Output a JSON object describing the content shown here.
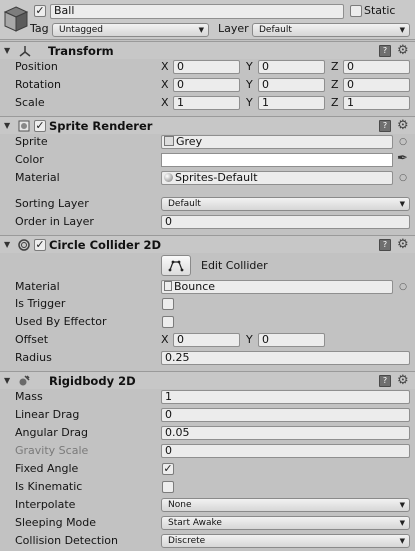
{
  "object": {
    "name": "Ball",
    "active": true,
    "static_label": "Static",
    "static": false,
    "tag_label": "Tag",
    "tag_value": "Untagged",
    "layer_label": "Layer",
    "layer_value": "Default"
  },
  "transform": {
    "title": "Transform",
    "position_label": "Position",
    "rotation_label": "Rotation",
    "scale_label": "Scale",
    "axis_x": "X",
    "axis_y": "Y",
    "axis_z": "Z",
    "position": {
      "x": "0",
      "y": "0",
      "z": "0"
    },
    "rotation": {
      "x": "0",
      "y": "0",
      "z": "0"
    },
    "scale": {
      "x": "1",
      "y": "1",
      "z": "1"
    }
  },
  "sprite_renderer": {
    "title": "Sprite Renderer",
    "enabled": true,
    "sprite_label": "Sprite",
    "sprite_value": "Grey",
    "color_label": "Color",
    "color_value": "#ffffff",
    "material_label": "Material",
    "material_value": "Sprites-Default",
    "sorting_layer_label": "Sorting Layer",
    "sorting_layer_value": "Default",
    "order_label": "Order in Layer",
    "order_value": "0"
  },
  "circle_collider": {
    "title": "Circle Collider 2D",
    "enabled": true,
    "edit_button": "Edit Collider",
    "material_label": "Material",
    "material_value": "Bounce",
    "is_trigger_label": "Is Trigger",
    "is_trigger": false,
    "used_by_effector_label": "Used By Effector",
    "used_by_effector": false,
    "offset_label": "Offset",
    "offset_x": "0",
    "offset_y": "0",
    "radius_label": "Radius",
    "radius_value": "0.25"
  },
  "rigidbody": {
    "title": "Rigidbody 2D",
    "mass_label": "Mass",
    "mass": "1",
    "linear_drag_label": "Linear Drag",
    "linear_drag": "0",
    "angular_drag_label": "Angular Drag",
    "angular_drag": "0.05",
    "gravity_scale_label": "Gravity Scale",
    "gravity_scale": "0",
    "fixed_angle_label": "Fixed Angle",
    "fixed_angle": true,
    "is_kinematic_label": "Is Kinematic",
    "is_kinematic": false,
    "interpolate_label": "Interpolate",
    "interpolate_value": "None",
    "sleeping_label": "Sleeping Mode",
    "sleeping_value": "Start Awake",
    "collision_label": "Collision Detection",
    "collision_value": "Discrete"
  },
  "glyphs": {
    "check": "✓",
    "dropdown_arrow": "▼",
    "fold_open": "▼",
    "gear": "⚙",
    "help": "?",
    "object_picker": "○",
    "eyedropper": "✒"
  },
  "icons": {
    "gameobject": "cube-icon",
    "transform": "axes-icon",
    "sprite_renderer": "sprite-icon",
    "circle_collider": "circle-icon",
    "rigidbody": "rigidbody-icon",
    "edit_collider": "polygon-edit-icon"
  }
}
